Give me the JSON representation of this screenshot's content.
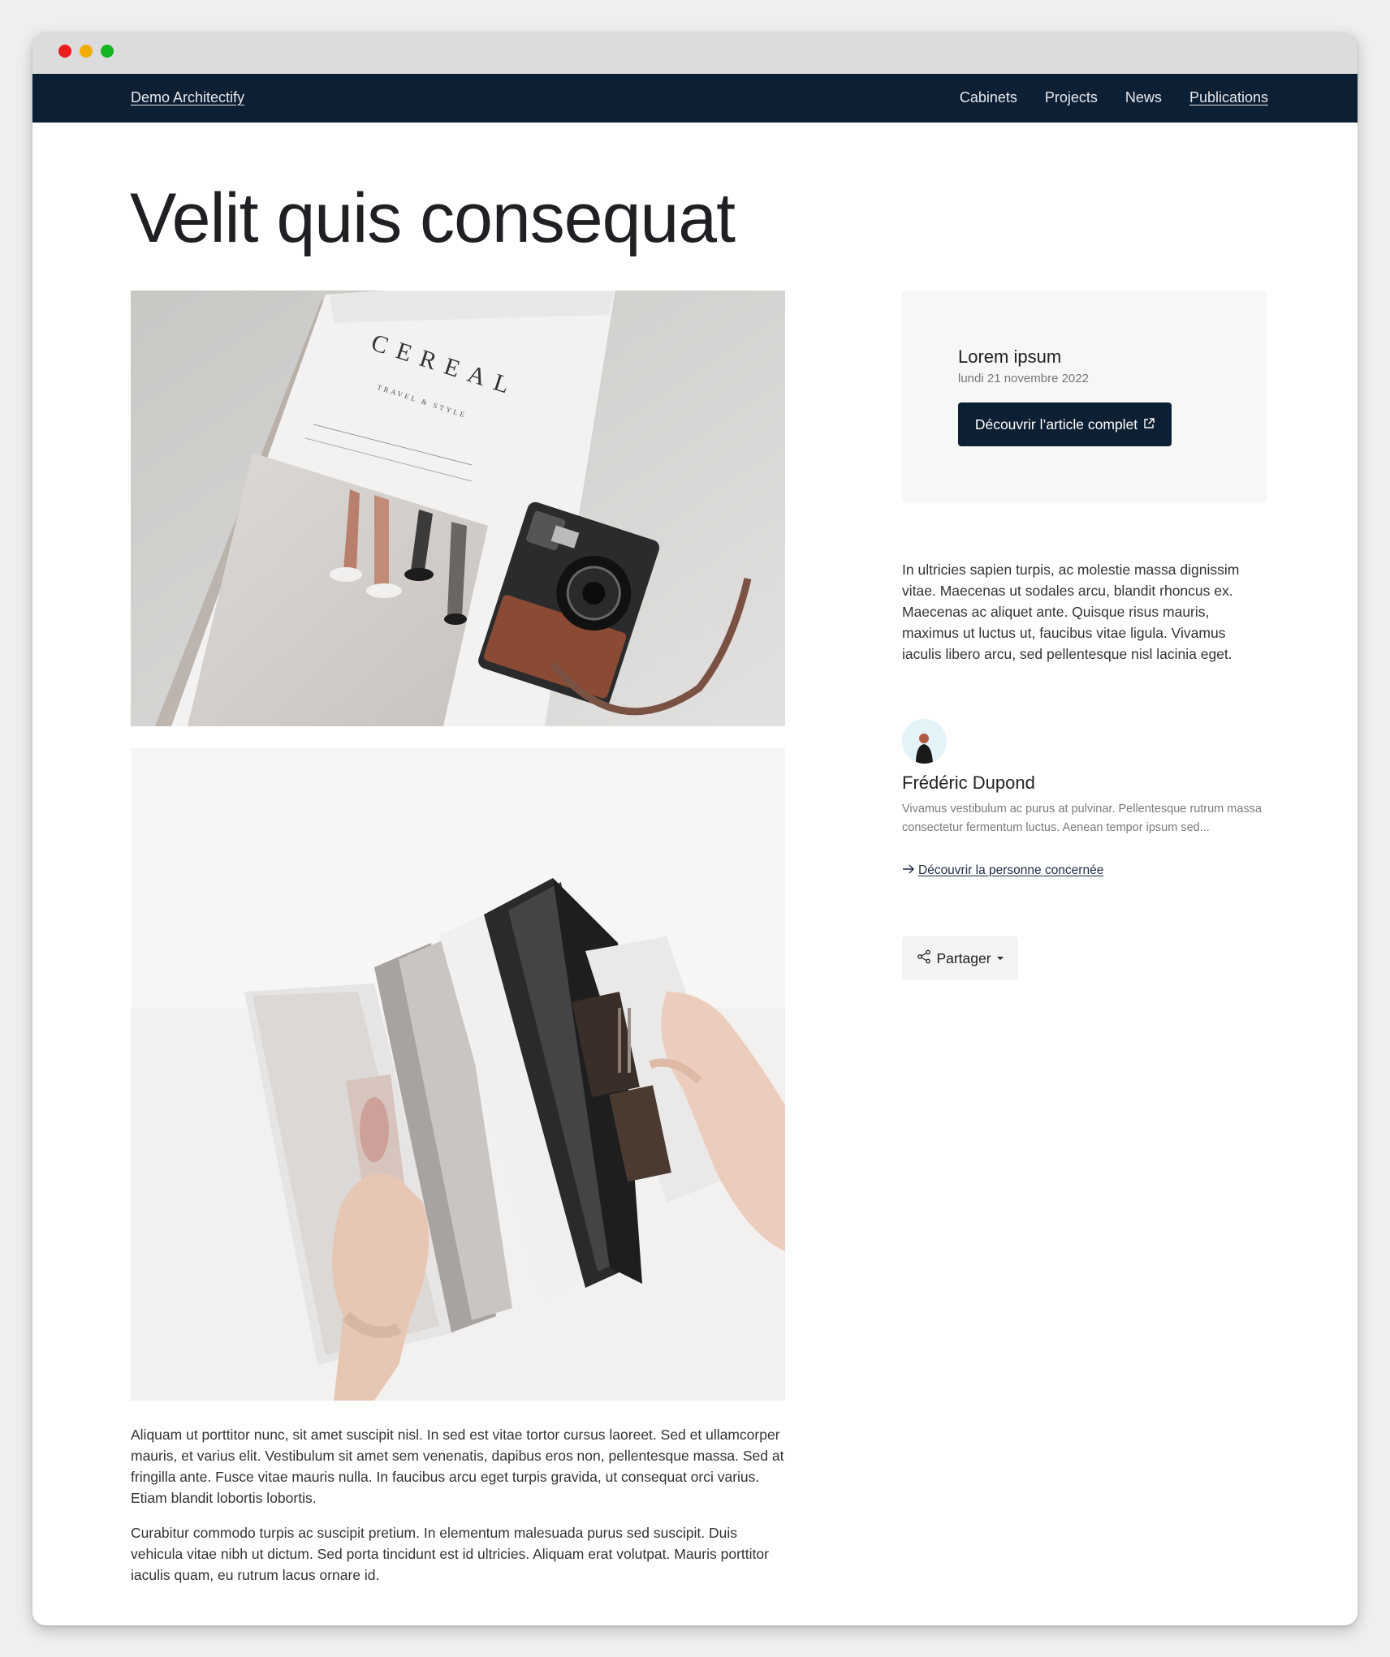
{
  "navbar": {
    "brand": "Demo Architectify",
    "links": [
      {
        "label": "Cabinets"
      },
      {
        "label": "Projects"
      },
      {
        "label": "News"
      },
      {
        "label": "Publications"
      }
    ]
  },
  "article": {
    "title": "Velit quis consequat",
    "paragraphs": [
      "Aliquam ut porttitor nunc, sit amet suscipit nisl. In sed est vitae tortor cursus laoreet. Sed et ullamcorper mauris, et varius elit. Vestibulum sit amet sem venenatis, dapibus eros non, pellentesque massa. Sed at fringilla ante. Fusce vitae mauris nulla. In faucibus arcu eget turpis gravida, ut consequat orci varius. Etiam blandit lobortis lobortis.",
      "Curabitur commodo turpis ac suscipit pretium. In elementum malesuada purus sed suscipit. Duis vehicula vitae nibh ut dictum. Sed porta tincidunt est id ultricies. Aliquam erat volutpat. Mauris porttitor iaculis quam, eu rutrum lacus ornare id."
    ],
    "image1_text": {
      "magazine": "CEREAL",
      "tagline": "TRAVEL & STYLE"
    }
  },
  "sidebar": {
    "card": {
      "title": "Lorem ipsum",
      "date": "lundi 21 novembre 2022",
      "button_label": "Découvrir l’article complet"
    },
    "summary": "In ultricies sapien turpis, ac molestie massa dignissim vitae. Maecenas ut sodales arcu, blandit rhoncus ex. Maecenas ac aliquet ante. Quisque risus mauris, maximus ut luctus ut, faucibus vitae ligula. Vivamus iaculis libero arcu, sed pellentesque nisl lacinia eget.",
    "person": {
      "name": "Frédéric Dupond",
      "bio": "Vivamus vestibulum ac purus at pulvinar. Pellentesque rutrum massa consectetur fermentum luctus. Aenean tempor ipsum sed...",
      "link_label": "Découvrir la personne concernée"
    },
    "share_label": "Partager"
  },
  "colors": {
    "navbar_bg": "#0d1f33",
    "button_bg": "#0d1f33",
    "card_bg": "#f6f7f7"
  }
}
